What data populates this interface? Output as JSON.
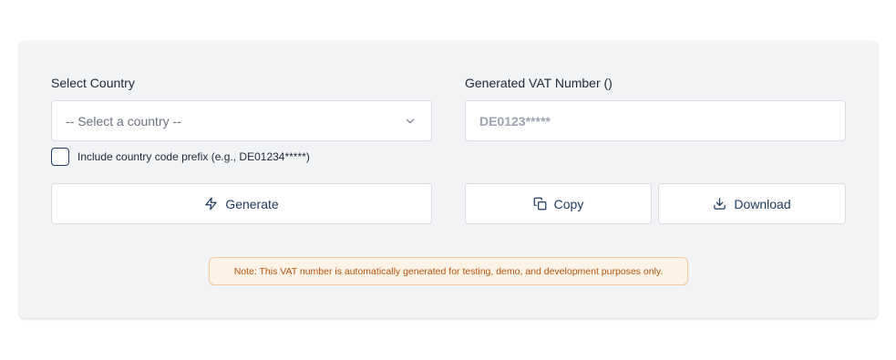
{
  "form": {
    "country_label": "Select Country",
    "country_placeholder": "-- Select a country --",
    "vat_label": "Generated VAT Number ()",
    "vat_placeholder": "DE0123*****",
    "vat_value": "",
    "prefix_checkbox_label": "Include country code prefix (e.g., DE01234*****)",
    "prefix_checked": false
  },
  "actions": {
    "generate_label": "Generate",
    "copy_label": "Copy",
    "download_label": "Download"
  },
  "note": {
    "text": "Note: This VAT number is automatically generated for testing, demo, and development purposes only."
  },
  "colors": {
    "card_bg": "#f2f3f5",
    "accent": "#1e3a5f",
    "note_bg": "#fdf2e6",
    "note_border": "#f7c99a",
    "note_text": "#b4540e"
  },
  "icons": {
    "select_chevron": "chevron-down-icon",
    "generate": "lightning-icon",
    "copy": "copy-icon",
    "download": "download-icon"
  }
}
